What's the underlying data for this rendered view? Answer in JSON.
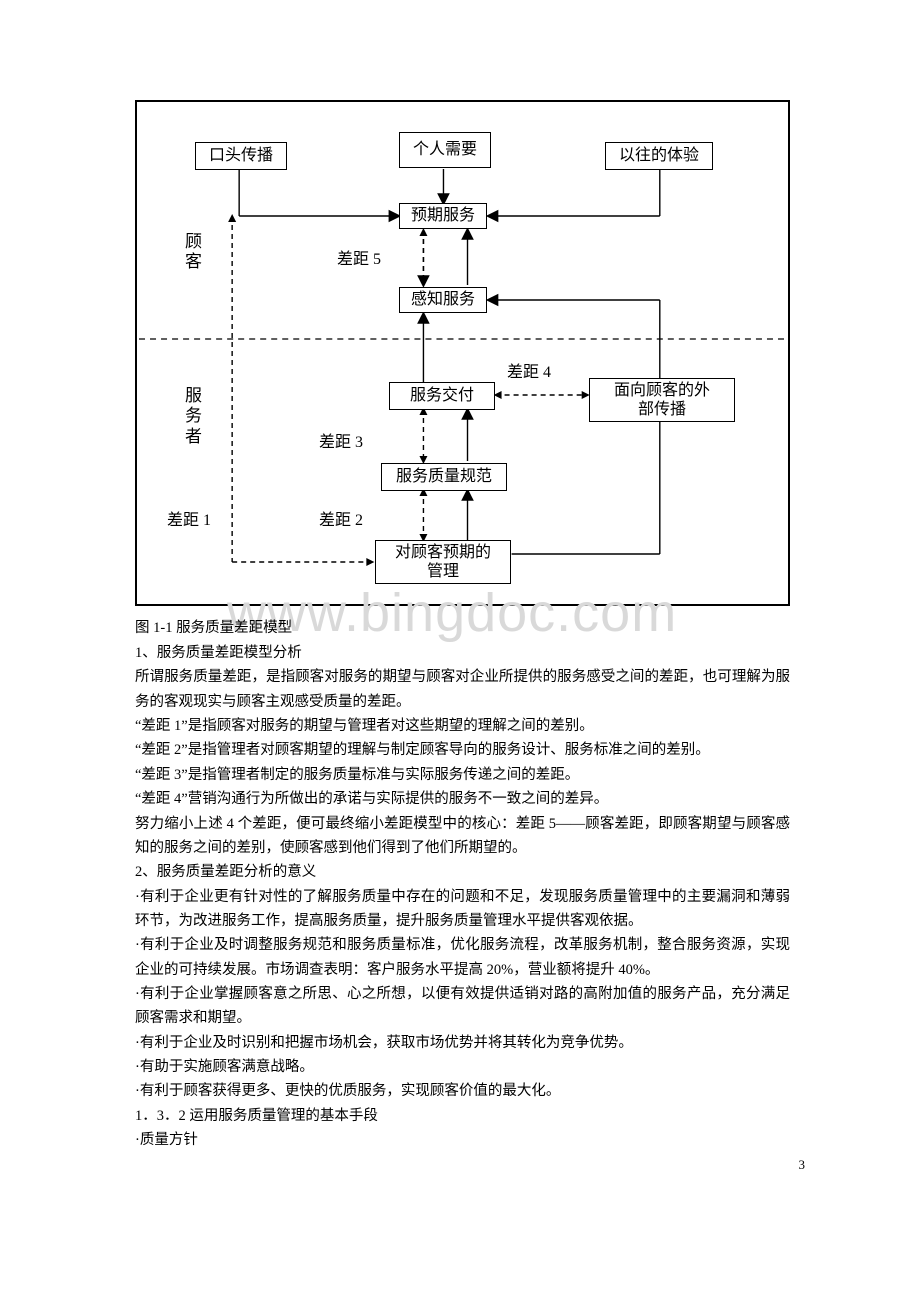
{
  "diagram": {
    "customer_label": "顾\n客",
    "provider_label": "服\n务\n者",
    "boxes": {
      "koutou": "口头传播",
      "geren": "个人需要",
      "yiwang": "以往的体验",
      "yuqi": "预期服务",
      "ganzhi": "感知服务",
      "jiaofu": "服务交付",
      "waibu": "面向顾客的外\n部传播",
      "guifan": "服务质量规范",
      "guanli": "对顾客预期的\n管理"
    },
    "gaps": {
      "g1": "差距 1",
      "g2": "差距 2",
      "g3": "差距 3",
      "g4": "差距 4",
      "g5": "差距 5"
    }
  },
  "caption": "图 1-1 服务质量差距模型",
  "heading1": "1、服务质量差距模型分析",
  "p1": "所谓服务质量差距，是指顾客对服务的期望与顾客对企业所提供的服务感受之间的差距，也可理解为服务的客观现实与顾客主观感受质量的差距。",
  "p2": "“差距 1”是指顾客对服务的期望与管理者对这些期望的理解之间的差别。",
  "p3": "“差距 2”是指管理者对顾客期望的理解与制定顾客导向的服务设计、服务标准之间的差别。",
  "p4": "“差距 3”是指管理者制定的服务质量标准与实际服务传递之间的差距。",
  "p5": "“差距 4”营销沟通行为所做出的承诺与实际提供的服务不一致之间的差异。",
  "p6": "努力缩小上述 4 个差距，便可最终缩小差距模型中的核心：差距 5——顾客差距，即顾客期望与顾客感知的服务之间的差别，使顾客感到他们得到了他们所期望的。",
  "heading2": "2、服务质量差距分析的意义",
  "b1": "·有利于企业更有针对性的了解服务质量中存在的问题和不足，发现服务质量管理中的主要漏洞和薄弱环节，为改进服务工作，提高服务质量，提升服务质量管理水平提供客观依据。",
  "b2": "·有利于企业及时调整服务规范和服务质量标准，优化服务流程，改革服务机制，整合服务资源，实现企业的可持续发展。市场调查表明：客户服务水平提高 20%，营业额将提升 40%。",
  "b3": "·有利于企业掌握顾客意之所思、心之所想，以便有效提供适销对路的高附加值的服务产品，充分满足顾客需求和期望。",
  "b4": "·有利于企业及时识别和把握市场机会，获取市场优势并将其转化为竞争优势。",
  "b5": "·有助于实施顾客满意战略。",
  "b6": "·有利于顾客获得更多、更快的优质服务，实现顾客价值的最大化。",
  "heading3": "1．3．2 运用服务质量管理的基本手段",
  "b7": "·质量方针",
  "watermark": "www.bingdoc.com",
  "page_num": "3"
}
